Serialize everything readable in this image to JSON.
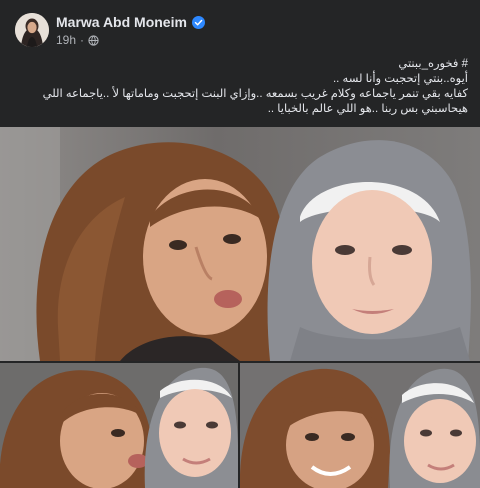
{
  "post": {
    "author": "Marwa Abd Moneim",
    "time": "19h",
    "separator": "·",
    "icons": {
      "verified": "verified-badge-icon",
      "audience": "globe-icon"
    },
    "text_lines": [
      "# فخوره_ببنتي",
      "أيوه..بنتي إتحجبت وأنا لسه ..",
      "كفايه بقي تنمر ياجماعه وكلام  غريب بسمعه ..وإزاي البنت إتحجبت وماماتها لأ ..ياجماعه اللي",
      "هيحاسبني بس ربنا ..هو اللي عالم بالخبايا .."
    ]
  },
  "colors": {
    "background": "#242526",
    "primary_text": "#e4e6eb",
    "secondary_text": "#b0b3b8",
    "verified_blue": "#2d88ff"
  }
}
